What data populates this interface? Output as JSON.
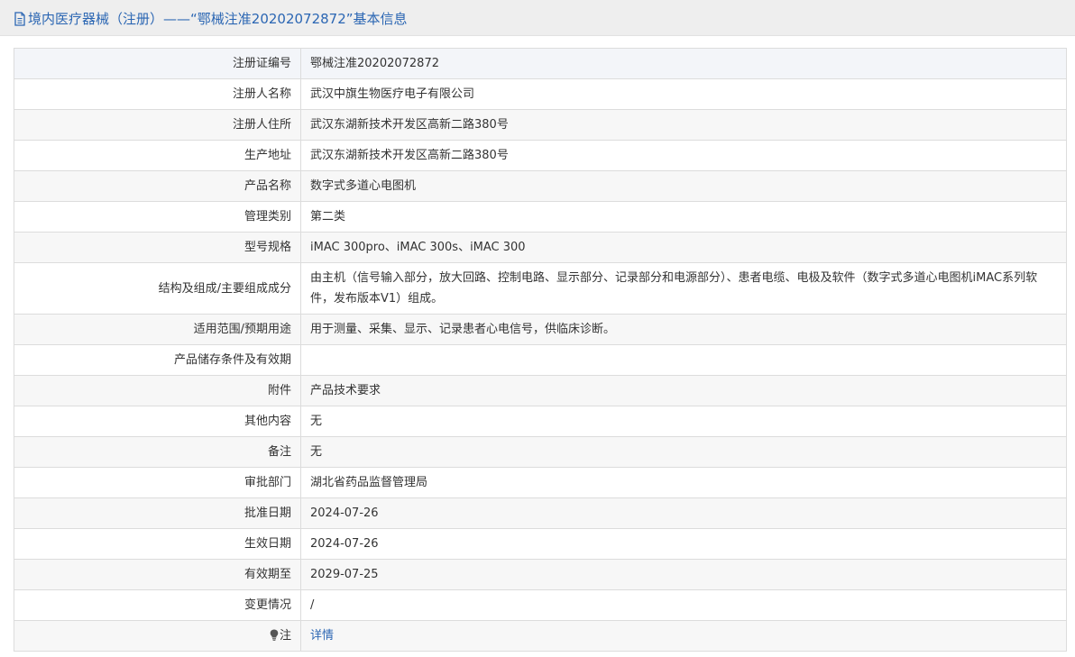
{
  "header": {
    "title": "境内医疗器械（注册）——“鄂械注准20202072872”基本信息",
    "icon": "document-icon"
  },
  "rows": [
    {
      "label": "注册证编号",
      "value": "鄂械注准20202072872"
    },
    {
      "label": "注册人名称",
      "value": "武汉中旗生物医疗电子有限公司"
    },
    {
      "label": "注册人住所",
      "value": "武汉东湖新技术开发区高新二路380号"
    },
    {
      "label": "生产地址",
      "value": "武汉东湖新技术开发区高新二路380号"
    },
    {
      "label": "产品名称",
      "value": "数字式多道心电图机"
    },
    {
      "label": "管理类别",
      "value": "第二类"
    },
    {
      "label": "型号规格",
      "value": "iMAC 300pro、iMAC 300s、iMAC 300"
    },
    {
      "label": "结构及组成/主要组成成分",
      "value": "由主机（信号输入部分，放大回路、控制电路、显示部分、记录部分和电源部分）、患者电缆、电极及软件（数字式多道心电图机iMAC系列软件，发布版本V1）组成。"
    },
    {
      "label": "适用范围/预期用途",
      "value": "用于测量、采集、显示、记录患者心电信号，供临床诊断。"
    },
    {
      "label": "产品储存条件及有效期",
      "value": ""
    },
    {
      "label": "附件",
      "value": "产品技术要求"
    },
    {
      "label": "其他内容",
      "value": "无"
    },
    {
      "label": "备注",
      "value": "无"
    },
    {
      "label": "审批部门",
      "value": "湖北省药品监督管理局"
    },
    {
      "label": "批准日期",
      "value": "2024-07-26"
    },
    {
      "label": "生效日期",
      "value": "2024-07-26"
    },
    {
      "label": "有效期至",
      "value": "2029-07-25"
    },
    {
      "label": "变更情况",
      "value": "/"
    }
  ],
  "note": {
    "label": "注",
    "icon": "lightbulb-icon",
    "link_text": "详情"
  },
  "colors": {
    "accent": "#2b66b3",
    "header_bg": "#eeeeee",
    "border": "#dcdcdc"
  }
}
